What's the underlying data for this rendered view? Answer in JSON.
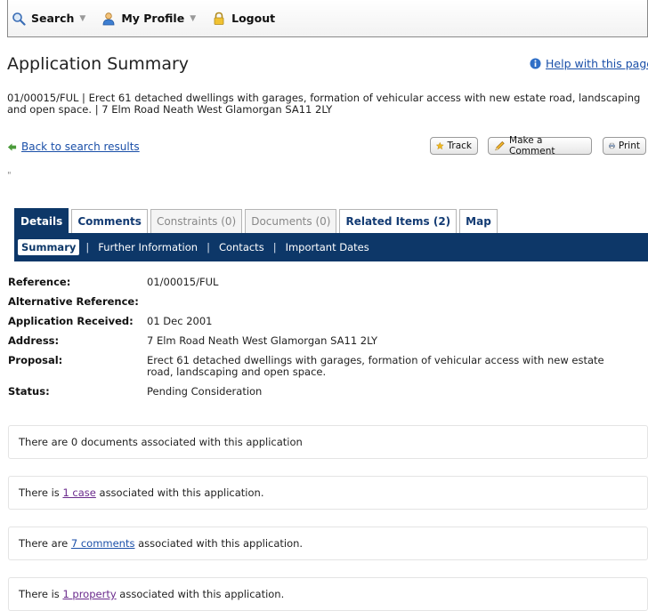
{
  "nav": {
    "search": "Search",
    "profile": "My Profile",
    "logout": "Logout"
  },
  "page": {
    "title": "Application Summary",
    "help": "Help with this page",
    "description": "01/00015/FUL | Erect 61 detached dwellings with garages, formation of vehicular access with new estate road, landscaping and open space. | 7 Elm Road Neath West Glamorgan SA11 2LY",
    "back": "Back to search results",
    "tick": "\""
  },
  "actions": {
    "track": "Track",
    "comment": "Make a Comment",
    "print": "Print"
  },
  "tabs": [
    {
      "label": "Details"
    },
    {
      "label": "Comments"
    },
    {
      "label": "Constraints (0)"
    },
    {
      "label": "Documents (0)"
    },
    {
      "label": "Related Items (2)"
    },
    {
      "label": "Map"
    }
  ],
  "subtabs": [
    {
      "label": "Summary"
    },
    {
      "label": "Further Information"
    },
    {
      "label": "Contacts"
    },
    {
      "label": "Important Dates"
    }
  ],
  "details": [
    {
      "key": "Reference:",
      "value": "01/00015/FUL"
    },
    {
      "key": "Alternative Reference:",
      "value": ""
    },
    {
      "key": "Application Received:",
      "value": "01 Dec 2001"
    },
    {
      "key": "Address:",
      "value": "7 Elm Road Neath West Glamorgan SA11 2LY"
    },
    {
      "key": "Proposal:",
      "value": "Erect 61 detached dwellings with garages, formation of vehicular access with new estate road, landscaping and open space."
    },
    {
      "key": "Status:",
      "value": "Pending Consideration"
    }
  ],
  "associations": {
    "documents": "There are 0 documents associated with this application",
    "cases_pre": "There is ",
    "cases_link": "1 case",
    "cases_post": " associated with this application.",
    "comments_pre": "There are ",
    "comments_link": "7 comments",
    "comments_post": " associated with this application.",
    "property_pre": "There is ",
    "property_link": "1 property",
    "property_post": " associated with this application."
  },
  "colors": {
    "navy": "#0d3768",
    "link": "#1a4fa8",
    "visited": "#6a2a8c"
  }
}
